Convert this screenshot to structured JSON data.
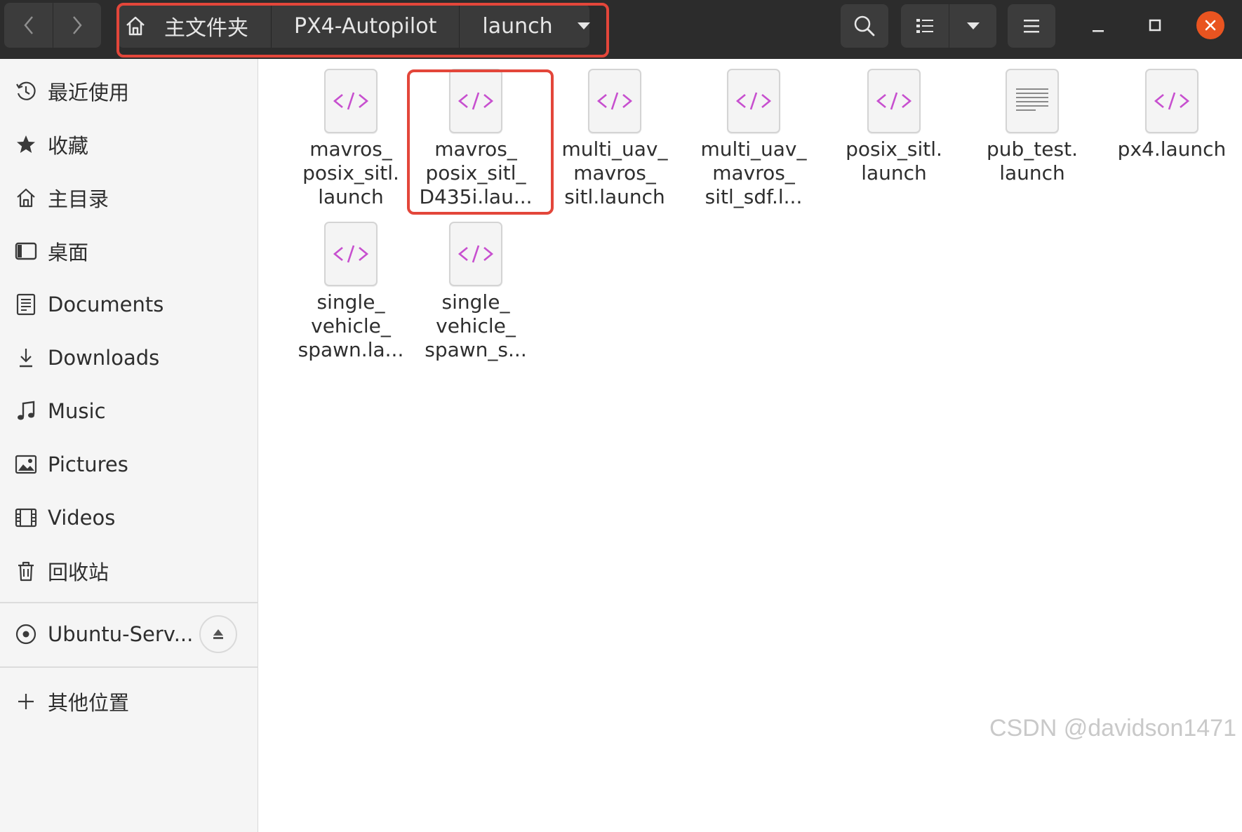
{
  "header": {
    "breadcrumbs": [
      {
        "label": "主文件夹"
      },
      {
        "label": "PX4-Autopilot"
      },
      {
        "label": "launch"
      }
    ]
  },
  "sidebar": {
    "items": [
      {
        "label": "最近使用",
        "icon": "clock-icon"
      },
      {
        "label": "收藏",
        "icon": "star-icon"
      },
      {
        "label": "主目录",
        "icon": "home-icon"
      },
      {
        "label": "桌面",
        "icon": "desktop-icon"
      },
      {
        "label": "Documents",
        "icon": "document-icon"
      },
      {
        "label": "Downloads",
        "icon": "download-icon"
      },
      {
        "label": "Music",
        "icon": "music-icon"
      },
      {
        "label": "Pictures",
        "icon": "picture-icon"
      },
      {
        "label": "Videos",
        "icon": "video-icon"
      },
      {
        "label": "回收站",
        "icon": "trash-icon"
      }
    ],
    "device": {
      "label": "Ubuntu-Serv...",
      "icon": "disc-icon"
    },
    "other": {
      "label": "其他位置",
      "icon": "plus-icon"
    }
  },
  "files": [
    {
      "label": "mavros_\nposix_sitl.\nlaunch",
      "type": "xml"
    },
    {
      "label": "mavros_\nposix_sitl_\nD435i.lau...",
      "type": "xml"
    },
    {
      "label": "multi_uav_\nmavros_\nsitl.launch",
      "type": "xml"
    },
    {
      "label": "multi_uav_\nmavros_\nsitl_sdf.l...",
      "type": "xml"
    },
    {
      "label": "posix_sitl.\nlaunch",
      "type": "xml"
    },
    {
      "label": "pub_test.\nlaunch",
      "type": "text"
    },
    {
      "label": "px4.launch",
      "type": "xml"
    },
    {
      "label": "single_\nvehicle_\nspawn.la...",
      "type": "xml"
    },
    {
      "label": "single_\nvehicle_\nspawn_s...",
      "type": "xml"
    }
  ],
  "colors": {
    "header_bg": "#2c2c2c",
    "highlight": "#e3463a",
    "close_button": "#e95420",
    "code_icon": "#c74fcf"
  },
  "watermark": "CSDN @davidson1471"
}
